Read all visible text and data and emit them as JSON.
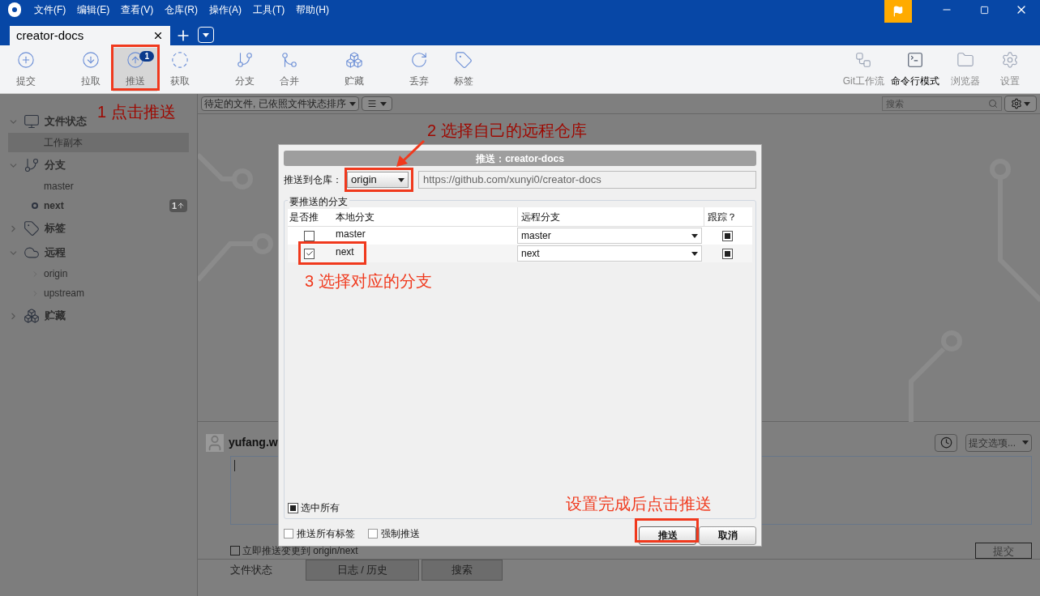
{
  "menu": [
    "文件(F)",
    "编辑(E)",
    "查看(V)",
    "仓库(R)",
    "操作(A)",
    "工具(T)",
    "帮助(H)"
  ],
  "tabs": [
    {
      "label": "creator-docs",
      "selected": true
    }
  ],
  "toolbar": [
    {
      "label": "提交",
      "pressed": false
    },
    {
      "label": "拉取",
      "pressed": false
    },
    {
      "label": "推送",
      "pressed": true,
      "badge": "1"
    },
    {
      "label": "获取",
      "pressed": false
    },
    {
      "label": "分支",
      "pressed": false
    },
    {
      "label": "合并",
      "pressed": false
    },
    {
      "label": "贮藏",
      "pressed": false
    },
    {
      "label": "丢弃",
      "pressed": false
    },
    {
      "label": "标签",
      "pressed": false
    }
  ],
  "toolbar_right": [
    {
      "label": "Git工作流",
      "disabled": true
    },
    {
      "label": "命令行模式",
      "disabled": false
    },
    {
      "label": "浏览器",
      "disabled": true
    },
    {
      "label": "设置",
      "disabled": true
    }
  ],
  "filter": {
    "sort": "待定的文件, 已依照文件状态排序",
    "search_placeholder": "搜索"
  },
  "sidebar": [
    {
      "label": "文件状态",
      "expanded": true,
      "children": [
        {
          "label": "工作副本",
          "selected": true
        }
      ]
    },
    {
      "label": "分支",
      "expanded": true,
      "children": [
        {
          "label": "master",
          "selected": false,
          "current": false
        },
        {
          "label": "next",
          "selected": false,
          "current": true,
          "badge": "1"
        }
      ]
    },
    {
      "label": "标签",
      "expanded": false
    },
    {
      "label": "远程",
      "expanded": true,
      "children": [
        {
          "label": "origin",
          "selected": false,
          "expanded": false
        },
        {
          "label": "upstream",
          "selected": false,
          "expanded": false
        }
      ]
    },
    {
      "label": "贮藏",
      "expanded": false
    }
  ],
  "commit": {
    "author": "yufang.w",
    "options": "提交选项...",
    "push_now": {
      "label": "立即推送变更到 origin/next",
      "checked": false
    },
    "submit": "提交"
  },
  "bottom_tabs": [
    {
      "label": "文件状态",
      "selected": true
    },
    {
      "label": "日志 / 历史",
      "selected": false
    },
    {
      "label": "搜索",
      "selected": false
    }
  ],
  "dialog": {
    "title": "推送：creator-docs",
    "repo_label": "推送到仓库：",
    "repo": "origin",
    "url": "https://github.com/xunyi0/creator-docs",
    "group": "要推送的分支",
    "columns": [
      "是否推",
      "本地分支",
      "远程分支",
      "跟踪？"
    ],
    "rows": [
      {
        "push": false,
        "local": "master",
        "remote": "master",
        "track": true
      },
      {
        "push": true,
        "local": "next",
        "remote": "next",
        "track": true
      }
    ],
    "select_all": {
      "label": "选中所有",
      "checked": true
    },
    "options": [
      {
        "label": "推送所有标签",
        "checked": false
      },
      {
        "label": "强制推送",
        "checked": false
      }
    ],
    "buttons": [
      {
        "label": "推送",
        "kind": "primary"
      },
      {
        "label": "取消",
        "kind": "secondary"
      }
    ]
  },
  "annotations": [
    "1 点击推送",
    "2 选择自己的远程仓库",
    "3 选择对应的分支",
    "设置完成后点击推送"
  ]
}
